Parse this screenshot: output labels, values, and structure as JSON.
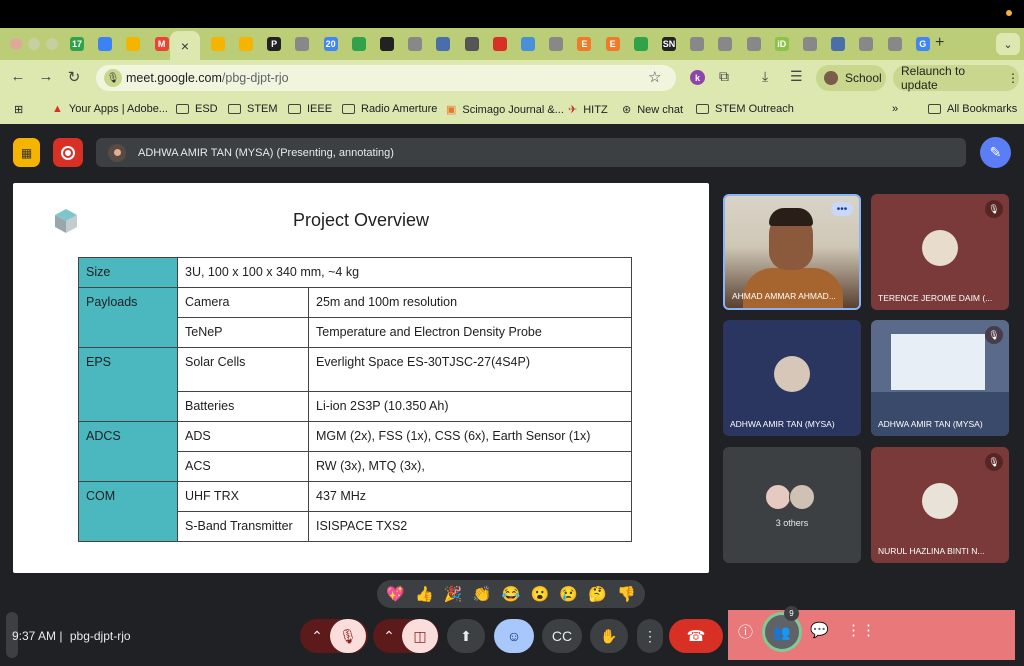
{
  "browser": {
    "url_domain": "meet.google.com",
    "url_path": "/pbg-djpt-rjo",
    "active_tab_close": "×",
    "new_tab": "+",
    "profile_label": "School",
    "relaunch_label": "Relaunch to update",
    "tabs": [
      {
        "icon": "chrome-icon",
        "color": "#2fa24a",
        "text": "17"
      },
      {
        "icon": "drive-icon",
        "color": "#3b82f6",
        "text": ""
      },
      {
        "icon": "slides-icon",
        "color": "#f5b400",
        "text": ""
      },
      {
        "icon": "gmail-icon",
        "color": "#ea4335",
        "text": "M"
      },
      {
        "icon": "tab-icon",
        "color": "#f5b400",
        "text": ""
      },
      {
        "icon": "tab-icon",
        "color": "#f5b400",
        "text": ""
      },
      {
        "icon": "pkf-icon",
        "color": "#222222",
        "text": "P"
      },
      {
        "icon": "tab-icon",
        "color": "#888888",
        "text": ""
      },
      {
        "icon": "calendar-icon",
        "color": "#4285f4",
        "text": "20"
      },
      {
        "icon": "drive-icon",
        "color": "#2fa24a",
        "text": ""
      },
      {
        "icon": "github-icon",
        "color": "#222222",
        "text": ""
      },
      {
        "icon": "doc-icon",
        "color": "#888888",
        "text": ""
      },
      {
        "icon": "gear-icon",
        "color": "#4a6ea9",
        "text": ""
      },
      {
        "icon": "tab-icon",
        "color": "#555555",
        "text": ""
      },
      {
        "icon": "tab-icon",
        "color": "#d93025",
        "text": ""
      },
      {
        "icon": "tab-icon",
        "color": "#4a90d9",
        "text": ""
      },
      {
        "icon": "tab-icon",
        "color": "#888888",
        "text": ""
      },
      {
        "icon": "elsevier-icon",
        "color": "#ef7a2a",
        "text": "E"
      },
      {
        "icon": "elsevier-icon",
        "color": "#ef7a2a",
        "text": "E"
      },
      {
        "icon": "tab-icon",
        "color": "#2fa24a",
        "text": ""
      },
      {
        "icon": "sn-icon",
        "color": "#222222",
        "text": "SN"
      },
      {
        "icon": "tab-icon",
        "color": "#888888",
        "text": ""
      },
      {
        "icon": "tab-icon",
        "color": "#888888",
        "text": ""
      },
      {
        "icon": "tab-icon",
        "color": "#888888",
        "text": ""
      },
      {
        "icon": "id-icon",
        "color": "#8bc34a",
        "text": "iD"
      },
      {
        "icon": "tab-icon",
        "color": "#888888",
        "text": ""
      },
      {
        "icon": "tab-icon",
        "color": "#4a6ea9",
        "text": ""
      },
      {
        "icon": "tab-icon",
        "color": "#888888",
        "text": ""
      },
      {
        "icon": "tab-icon",
        "color": "#888888",
        "text": ""
      },
      {
        "icon": "google-icon",
        "color": "#4285f4",
        "text": "G"
      }
    ]
  },
  "bookmarks": {
    "items": [
      {
        "label": "Your Apps | Adobe...",
        "icon": "adobe-icon"
      },
      {
        "label": "ESD",
        "icon": "folder-icon"
      },
      {
        "label": "STEM",
        "icon": "folder-icon"
      },
      {
        "label": "IEEE",
        "icon": "folder-icon"
      },
      {
        "label": "Radio Amerture",
        "icon": "folder-icon"
      },
      {
        "label": "Scimago Journal &...",
        "icon": "sjr-icon"
      },
      {
        "label": "HITZ",
        "icon": "hitz-icon"
      },
      {
        "label": "New chat",
        "icon": "openai-icon"
      },
      {
        "label": "STEM Outreach",
        "icon": "folder-icon"
      }
    ],
    "overflow": "»",
    "all_label": "All Bookmarks"
  },
  "presenting": {
    "label": "ADHWA AMIR TAN (MYSA) (Presenting, annotating)"
  },
  "slide": {
    "title": "Project Overview",
    "rows": [
      {
        "cat": "Size",
        "sub": "3U, 100 x 100 x 340 mm, ~4 kg",
        "val": "",
        "span": true
      },
      {
        "cat": "Payloads",
        "sub": "Camera",
        "val": "25m and 100m resolution"
      },
      {
        "cat": "",
        "sub": "TeNeP",
        "val": "Temperature and Electron Density Probe"
      },
      {
        "cat": "EPS",
        "sub": "Solar Cells",
        "val": "Everlight Space ES-30TJSC-27(4S4P)",
        "tall": true
      },
      {
        "cat": "",
        "sub": "Batteries",
        "val": "Li-ion 2S3P (10.350 Ah)"
      },
      {
        "cat": "ADCS",
        "sub": "ADS",
        "val": "MGM (2x), FSS (1x), CSS (6x), Earth Sensor (1x)"
      },
      {
        "cat": "",
        "sub": "ACS",
        "val": "RW (3x), MTQ (3x),"
      },
      {
        "cat": "COM",
        "sub": "UHF TRX",
        "val": "437 MHz"
      },
      {
        "cat": "",
        "sub": "S-Band Transmitter",
        "val": "ISISPACE TXS2"
      }
    ]
  },
  "participants": {
    "tile1": "AHMAD AMMAR AHMAD...",
    "tile2": "TERENCE JEROME DAIM (...",
    "tile3": "ADHWA AMIR TAN (MYSA)",
    "tile4": "ADHWA AMIR TAN (MYSA)",
    "tile5": "3 others",
    "tile6": "NURUL HAZLINA BINTI N...",
    "count": "9"
  },
  "reactions": [
    "💖",
    "👍",
    "🎉",
    "👏",
    "😂",
    "😮",
    "😢",
    "🤔",
    "👎"
  ],
  "bottom": {
    "time": "9:37 AM",
    "separator": "|",
    "meeting_code": "pbg-djpt-rjo"
  }
}
